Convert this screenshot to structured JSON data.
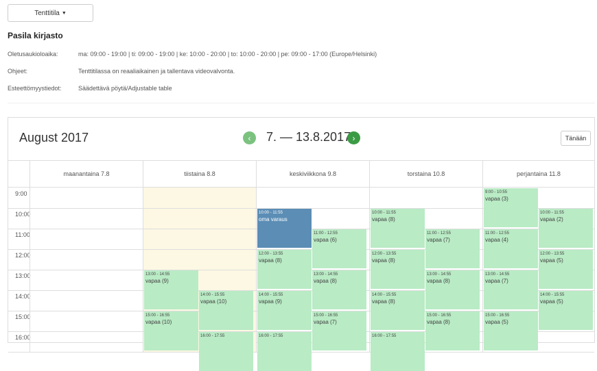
{
  "dropdown": {
    "label": "Tenttitila"
  },
  "library": {
    "title": "Pasila kirjasto",
    "rows": [
      {
        "label": "Oletusaukioloaika:",
        "value": "ma: 09:00 - 19:00 | ti: 09:00 - 19:00 | ke: 10:00 - 20:00 | to: 10:00 - 20:00 | pe: 09:00 - 17:00 (Europe/Helsinki)"
      },
      {
        "label": "Ohjeet:",
        "value": "Tenttitilassa on reaaliaikainen ja tallentava videovalvonta."
      },
      {
        "label": "Esteettömyystiedot:",
        "value": "Säädettävä pöytä/Adjustable table"
      }
    ]
  },
  "calendar": {
    "month": "August 2017",
    "range": "7. — 13.8.2017",
    "today_label": "Tänään",
    "prev_icon": "chevron-left-icon",
    "next_icon": "chevron-right-icon",
    "days": [
      "maanantaina 7.8",
      "tiistaina 8.8",
      "keskiviikkona 9.8",
      "torstaina 10.8",
      "perjantaina 11.8"
    ],
    "times": [
      "9:00",
      "10:00",
      "11:00",
      "12:00",
      "13:00",
      "14:00",
      "15:00",
      "16:00"
    ],
    "colors": {
      "free": "#b9ebc5",
      "own": "#5b8db5",
      "today": "#fcf8e3",
      "nav_prev": "#7bc27f",
      "nav_next": "#3b9b44"
    },
    "events": [
      {
        "day": 1,
        "col": 0,
        "start": 13,
        "time": "13:00 - 14:55",
        "status": "vapaa (9)"
      },
      {
        "day": 1,
        "col": 1,
        "start": 14,
        "time": "14:00 - 15:55",
        "status": "vapaa (10)"
      },
      {
        "day": 1,
        "col": 0,
        "start": 15,
        "time": "15:00 - 16:55",
        "status": "vapaa (10)"
      },
      {
        "day": 1,
        "col": 1,
        "start": 16,
        "time": "16:00 - 17:55",
        "status": ""
      },
      {
        "day": 2,
        "col": 0,
        "start": 10,
        "time": "10:00 - 11:55",
        "status": "oma varaus",
        "own": true
      },
      {
        "day": 2,
        "col": 1,
        "start": 11,
        "time": "11:00 - 12:55",
        "status": "vapaa (6)"
      },
      {
        "day": 2,
        "col": 0,
        "start": 12,
        "time": "12:00 - 13:55",
        "status": "vapaa (8)"
      },
      {
        "day": 2,
        "col": 1,
        "start": 13,
        "time": "13:00 - 14:55",
        "status": "vapaa (8)"
      },
      {
        "day": 2,
        "col": 0,
        "start": 14,
        "time": "14:00 - 15:55",
        "status": "vapaa (9)"
      },
      {
        "day": 2,
        "col": 1,
        "start": 15,
        "time": "15:00 - 16:55",
        "status": "vapaa (7)"
      },
      {
        "day": 2,
        "col": 0,
        "start": 16,
        "time": "16:00 - 17:55",
        "status": ""
      },
      {
        "day": 3,
        "col": 0,
        "start": 10,
        "time": "10:00 - 11:55",
        "status": "vapaa (8)"
      },
      {
        "day": 3,
        "col": 1,
        "start": 11,
        "time": "11:00 - 12:55",
        "status": "vapaa (7)"
      },
      {
        "day": 3,
        "col": 0,
        "start": 12,
        "time": "12:00 - 13:55",
        "status": "vapaa (8)"
      },
      {
        "day": 3,
        "col": 1,
        "start": 13,
        "time": "13:00 - 14:55",
        "status": "vapaa (8)"
      },
      {
        "day": 3,
        "col": 0,
        "start": 14,
        "time": "14:00 - 15:55",
        "status": "vapaa (8)"
      },
      {
        "day": 3,
        "col": 1,
        "start": 15,
        "time": "15:00 - 16:55",
        "status": "vapaa (8)"
      },
      {
        "day": 3,
        "col": 0,
        "start": 16,
        "time": "16:00 - 17:55",
        "status": ""
      },
      {
        "day": 4,
        "col": 0,
        "start": 9,
        "time": "9:00 - 10:55",
        "status": "vapaa (3)"
      },
      {
        "day": 4,
        "col": 1,
        "start": 10,
        "time": "10:00 - 11:55",
        "status": "vapaa (2)"
      },
      {
        "day": 4,
        "col": 0,
        "start": 11,
        "time": "11:00 - 12:55",
        "status": "vapaa (4)"
      },
      {
        "day": 4,
        "col": 1,
        "start": 12,
        "time": "12:00 - 13:55",
        "status": "vapaa (5)"
      },
      {
        "day": 4,
        "col": 0,
        "start": 13,
        "time": "13:00 - 14:55",
        "status": "vapaa (7)"
      },
      {
        "day": 4,
        "col": 1,
        "start": 14,
        "time": "14:00 - 15:55",
        "status": "vapaa (5)"
      },
      {
        "day": 4,
        "col": 0,
        "start": 15,
        "time": "15:00 - 16:55",
        "status": "vapaa (5)"
      }
    ]
  }
}
